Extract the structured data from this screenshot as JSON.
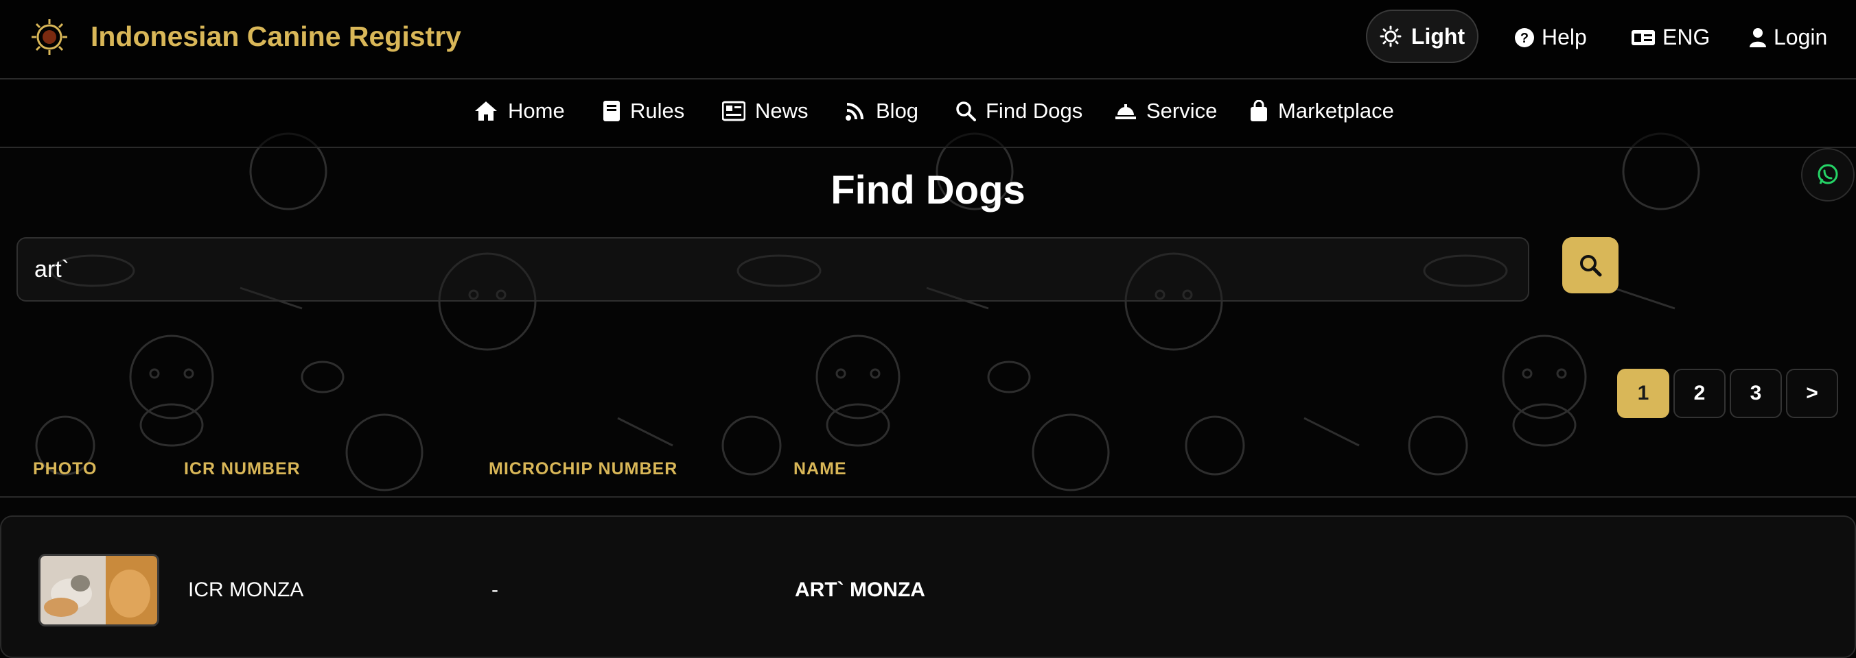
{
  "header": {
    "brand": "Indonesian Canine Registry",
    "theme_label": "Light",
    "help_label": "Help",
    "lang_label": "ENG",
    "login_label": "Login"
  },
  "nav": {
    "items": [
      {
        "label": "Home",
        "icon": "home-icon"
      },
      {
        "label": "Rules",
        "icon": "book-icon"
      },
      {
        "label": "News",
        "icon": "newspaper-icon"
      },
      {
        "label": "Blog",
        "icon": "blog-icon"
      },
      {
        "label": "Find Dogs",
        "icon": "search-icon"
      },
      {
        "label": "Service",
        "icon": "service-bell-icon"
      },
      {
        "label": "Marketplace",
        "icon": "shopping-bag-icon"
      }
    ]
  },
  "page": {
    "title": "Find Dogs"
  },
  "search": {
    "value": "art`",
    "placeholder": ""
  },
  "pagination": {
    "pages": [
      "1",
      "2",
      "3"
    ],
    "current": "1",
    "next_label": ">"
  },
  "table": {
    "headers": [
      "PHOTO",
      "ICR NUMBER",
      "MICROCHIP NUMBER",
      "NAME"
    ],
    "rows": [
      {
        "icr_number": "ICR MONZA",
        "microchip_number": "-",
        "name": "ART` MONZA"
      }
    ]
  },
  "colors": {
    "accent": "#d9b758",
    "background": "#050505",
    "whatsapp": "#25d366"
  }
}
